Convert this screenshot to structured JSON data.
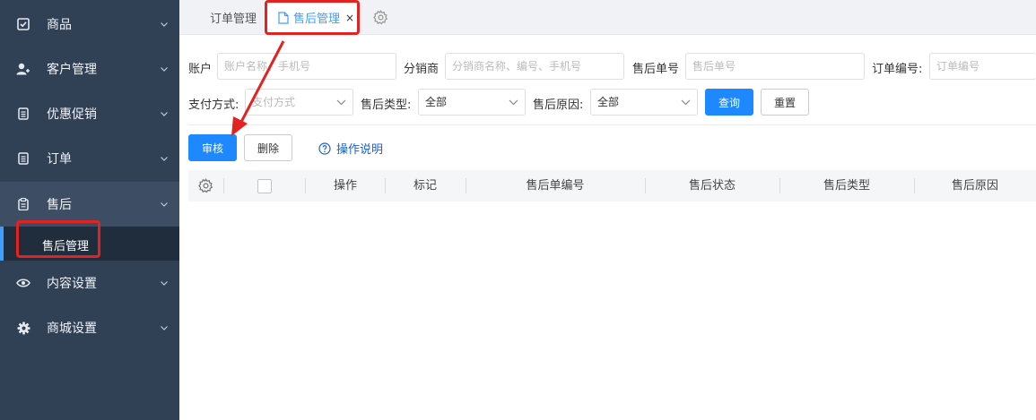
{
  "sidebar": {
    "items": [
      {
        "label": "商品",
        "icon": "product-check-icon"
      },
      {
        "label": "客户管理",
        "icon": "customer-user-icon"
      },
      {
        "label": "优惠促销",
        "icon": "promotion-list-icon"
      },
      {
        "label": "订单",
        "icon": "order-list-icon"
      },
      {
        "label": "售后",
        "icon": "clipboard-icon"
      },
      {
        "label": "内容设置",
        "icon": "eye-icon"
      },
      {
        "label": "商城设置",
        "icon": "gear-icon"
      }
    ],
    "active_submenu": "售后管理"
  },
  "tabs": {
    "items": [
      {
        "label": "订单管理"
      },
      {
        "label": "售后管理",
        "close": "×"
      }
    ]
  },
  "filters": {
    "account": {
      "label": "账户",
      "placeholder": "账户名称、手机号"
    },
    "distributor": {
      "label": "分销商",
      "placeholder": "分销商名称、编号、手机号"
    },
    "aftersale_no": {
      "label": "售后单号",
      "placeholder": "售后单号"
    },
    "order_no": {
      "label": "订单编号:",
      "placeholder": "订单编号"
    },
    "pay_method": {
      "label": "支付方式:",
      "placeholder": "支付方式"
    },
    "aftersale_type": {
      "label": "售后类型:",
      "value": "全部"
    },
    "aftersale_reason": {
      "label": "售后原因:",
      "value": "全部"
    },
    "query_label": "查询",
    "reset_label": "重置"
  },
  "actions": {
    "approve_label": "审核",
    "delete_label": "删除",
    "help_label": "操作说明"
  },
  "table": {
    "columns": [
      "操作",
      "标记",
      "售后单编号",
      "售后状态",
      "售后类型",
      "售后原因"
    ]
  },
  "colors": {
    "sidebar_bg": "#304156",
    "primary": "#1e89ff",
    "annotation": "#e32222"
  }
}
